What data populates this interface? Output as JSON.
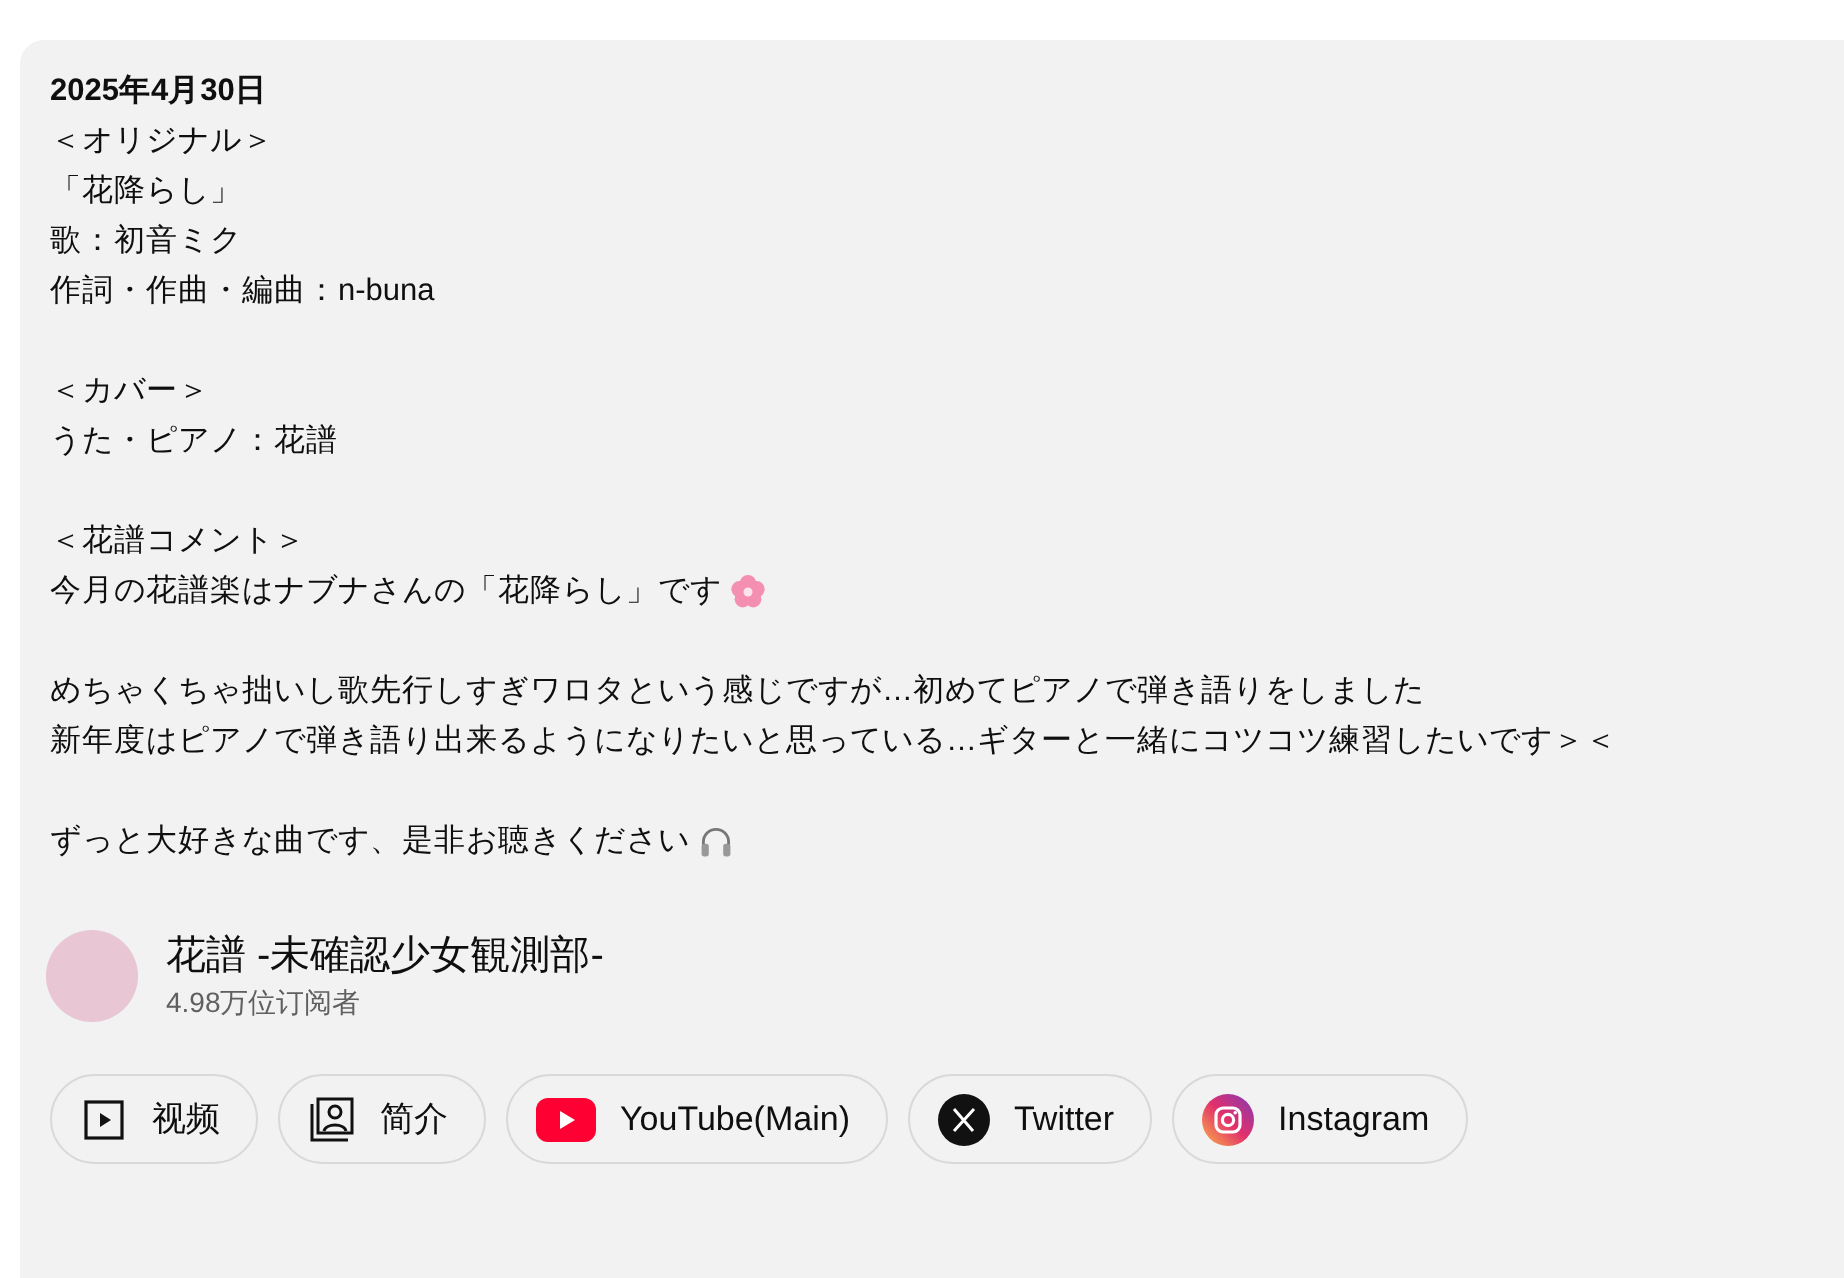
{
  "description": {
    "date": "2025年4月30日",
    "paragraphs": [
      {
        "lines": [
          {
            "kind": "plain",
            "text": "＜オリジナル＞"
          },
          {
            "kind": "plain",
            "text": "「花降らし」"
          },
          {
            "kind": "plain",
            "text": "歌：初音ミク"
          },
          {
            "kind": "plain",
            "text": "作詞・作曲・編曲：n-buna"
          }
        ]
      },
      {
        "lines": [
          {
            "kind": "plain",
            "text": "＜カバー＞"
          },
          {
            "kind": "plain",
            "text": "うた・ピアノ：花譜"
          }
        ]
      },
      {
        "lines": [
          {
            "kind": "plain",
            "text": "＜花譜コメント＞"
          },
          {
            "kind": "blossom",
            "text": "今月の花譜楽はナブナさんの「花降らし」です"
          }
        ]
      },
      {
        "lines": [
          {
            "kind": "plain",
            "text": "めちゃくちゃ拙いし歌先行しすぎワロタという感じですが…初めてピアノで弾き語りをしました"
          },
          {
            "kind": "plain",
            "text": "新年度はピアノで弾き語り出来るようになりたいと思っている…ギターと一緒にコツコツ練習したいです＞＜"
          }
        ]
      },
      {
        "lines": [
          {
            "kind": "listening",
            "text": "ずっと大好きな曲です、是非お聴きください"
          }
        ]
      }
    ]
  },
  "channel": {
    "name": "花譜 -未確認少女観測部-",
    "subscribers": "4.98万位订阅者"
  },
  "links": [
    {
      "kind": "videos",
      "label": "视频"
    },
    {
      "kind": "about",
      "label": "简介"
    },
    {
      "kind": "youtube",
      "label": "YouTube(Main)"
    },
    {
      "kind": "twitter",
      "label": "Twitter"
    },
    {
      "kind": "instagram",
      "label": "Instagram"
    }
  ]
}
